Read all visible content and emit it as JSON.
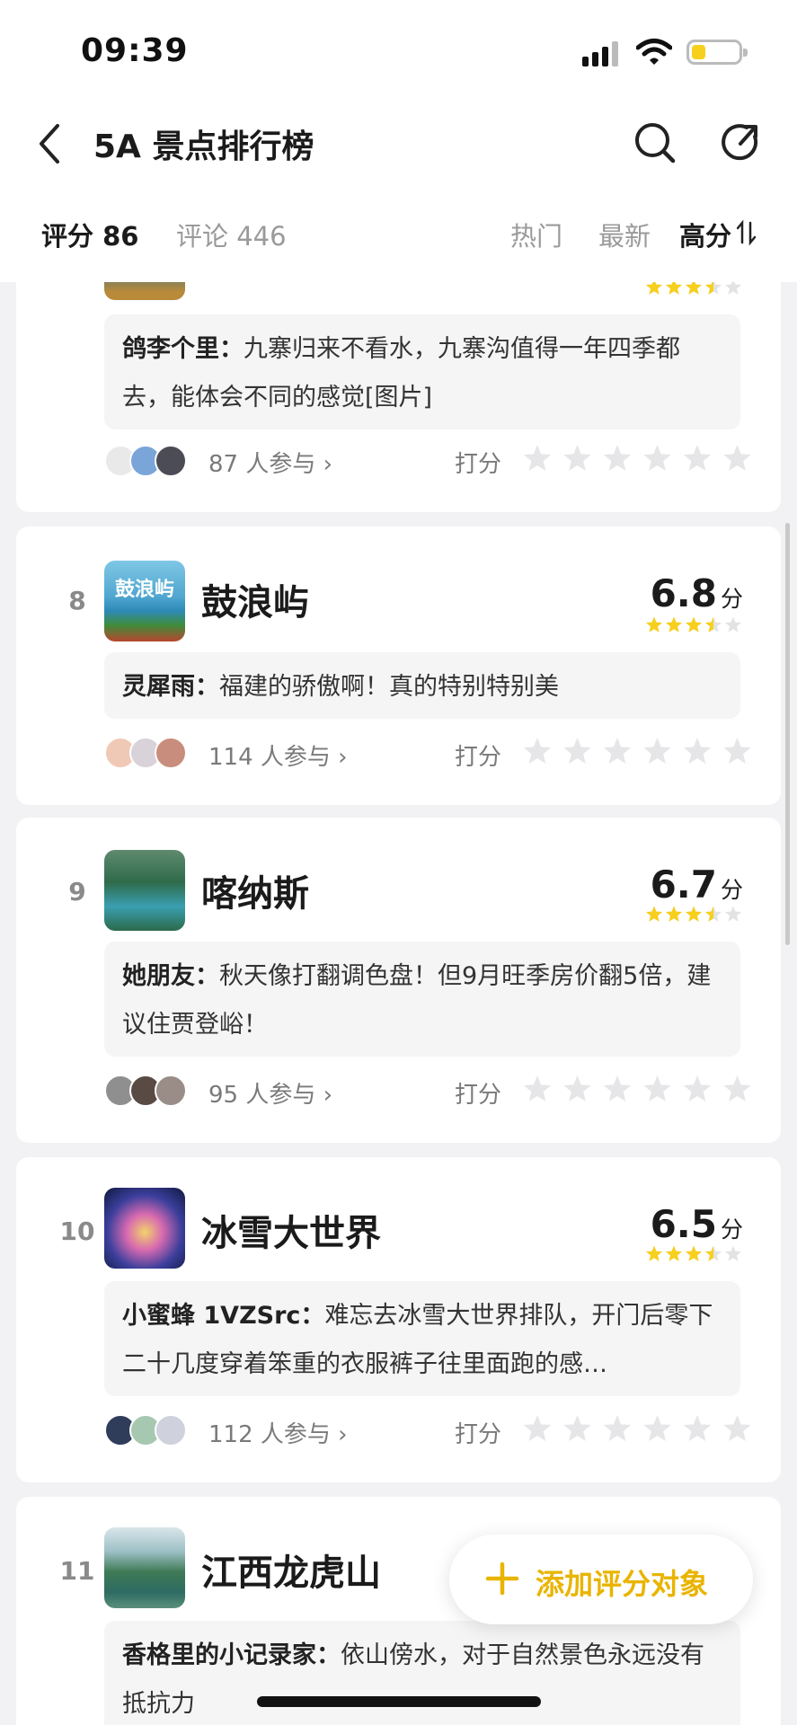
{
  "status": {
    "time": "09:39",
    "battery_level": 0.28
  },
  "nav": {
    "title": "5A 景点排行榜",
    "icons": [
      "back-icon",
      "search-icon",
      "share-icon"
    ]
  },
  "tabs": {
    "score": "评分 86",
    "comment": "评论 446",
    "hot": "热门",
    "newest": "最新",
    "high": "高分"
  },
  "colors": {
    "accent": "#f7cf1d",
    "button_text": "#e9b400",
    "page_bg": "#f2f2f4"
  },
  "items": [
    {
      "rank": "",
      "name": "",
      "score": "",
      "unit": "",
      "stars": 3.5,
      "comment_author": "鸽李个里：",
      "comment_text": "九寨归来不看水，九寨沟值得一年四季都去，能体会不同的感觉[图片]",
      "participants": "87 人参与 ›",
      "rate_label": "打分"
    },
    {
      "rank": "8",
      "name": "鼓浪屿",
      "score": "6.8",
      "unit": "分",
      "stars": 3.5,
      "thumb_text": "鼓浪屿",
      "comment_author": "灵犀雨：",
      "comment_text": "福建的骄傲啊！真的特别特别美",
      "participants": "114 人参与 ›",
      "rate_label": "打分"
    },
    {
      "rank": "9",
      "name": "喀纳斯",
      "score": "6.7",
      "unit": "分",
      "stars": 3.5,
      "comment_author": "她朋友：",
      "comment_text": "秋天像打翻调色盘！但9月旺季房价翻5倍，建议住贾登峪！",
      "participants": "95 人参与 ›",
      "rate_label": "打分"
    },
    {
      "rank": "10",
      "name": "冰雪大世界",
      "score": "6.5",
      "unit": "分",
      "stars": 3.5,
      "comment_author": "小蜜蜂 1VZSrc：",
      "comment_text": "难忘去冰雪大世界排队，开门后零下二十几度穿着笨重的衣服裤子往里面跑的感…",
      "participants": "112 人参与 ›",
      "rate_label": "打分"
    },
    {
      "rank": "11",
      "name": "江西龙虎山",
      "score": "",
      "unit": "",
      "stars": 0,
      "comment_author": "香格里的小记录家：",
      "comment_text": "依山傍水，对于自然景色永远没有抵抗力",
      "participants": "",
      "rate_label": ""
    }
  ],
  "add_button": {
    "label": "添加评分对象"
  }
}
